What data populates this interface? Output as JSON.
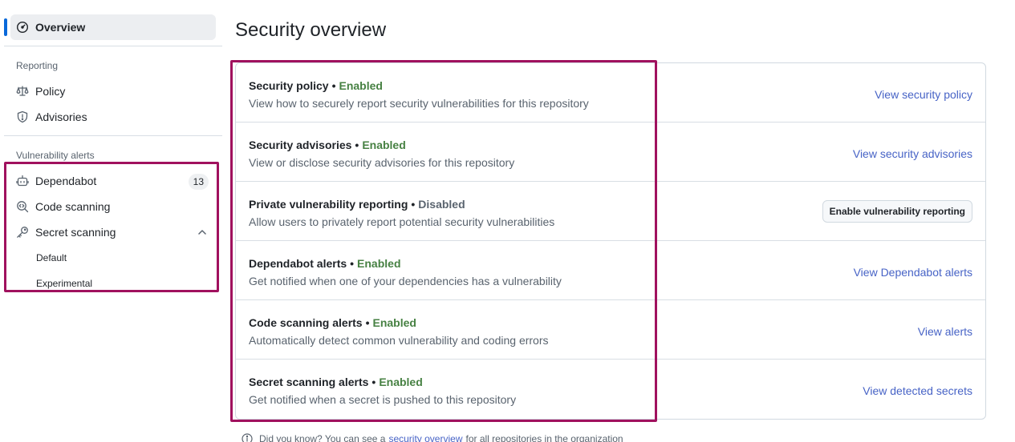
{
  "sidebar": {
    "overview_label": "Overview",
    "reporting_title": "Reporting",
    "policy_label": "Policy",
    "advisories_label": "Advisories",
    "vuln_title": "Vulnerability alerts",
    "dependabot_label": "Dependabot",
    "dependabot_count": "13",
    "code_scanning_label": "Code scanning",
    "secret_scanning_label": "Secret scanning",
    "default_label": "Default",
    "experimental_label": "Experimental"
  },
  "main": {
    "title": "Security overview",
    "rows": [
      {
        "title": "Security policy",
        "status": "Enabled",
        "description": "View how to securely report security vulnerabilities for this repository",
        "action": "View security policy"
      },
      {
        "title": "Security advisories",
        "status": "Enabled",
        "description": "View or disclose security advisories for this repository",
        "action": "View security advisories"
      },
      {
        "title": "Private vulnerability reporting",
        "status": "Disabled",
        "description": "Allow users to privately report potential security vulnerabilities",
        "action": "Enable vulnerability reporting"
      },
      {
        "title": "Dependabot alerts",
        "status": "Enabled",
        "description": "Get notified when one of your dependencies has a vulnerability",
        "action": "View Dependabot alerts"
      },
      {
        "title": "Code scanning alerts",
        "status": "Enabled",
        "description": "Automatically detect common vulnerability and coding errors",
        "action": "View alerts"
      },
      {
        "title": "Secret scanning alerts",
        "status": "Enabled",
        "description": "Get notified when a secret is pushed to this repository",
        "action": "View detected secrets"
      }
    ],
    "separator": "•",
    "footer": {
      "prefix": "Did you know? You can see a",
      "link": "security overview",
      "suffix": "for all repositories in the organization"
    }
  },
  "colors": {
    "enabled": "#478143",
    "link": "#4763c6",
    "highlight": "#a0115e",
    "active_indicator": "#0969da"
  }
}
